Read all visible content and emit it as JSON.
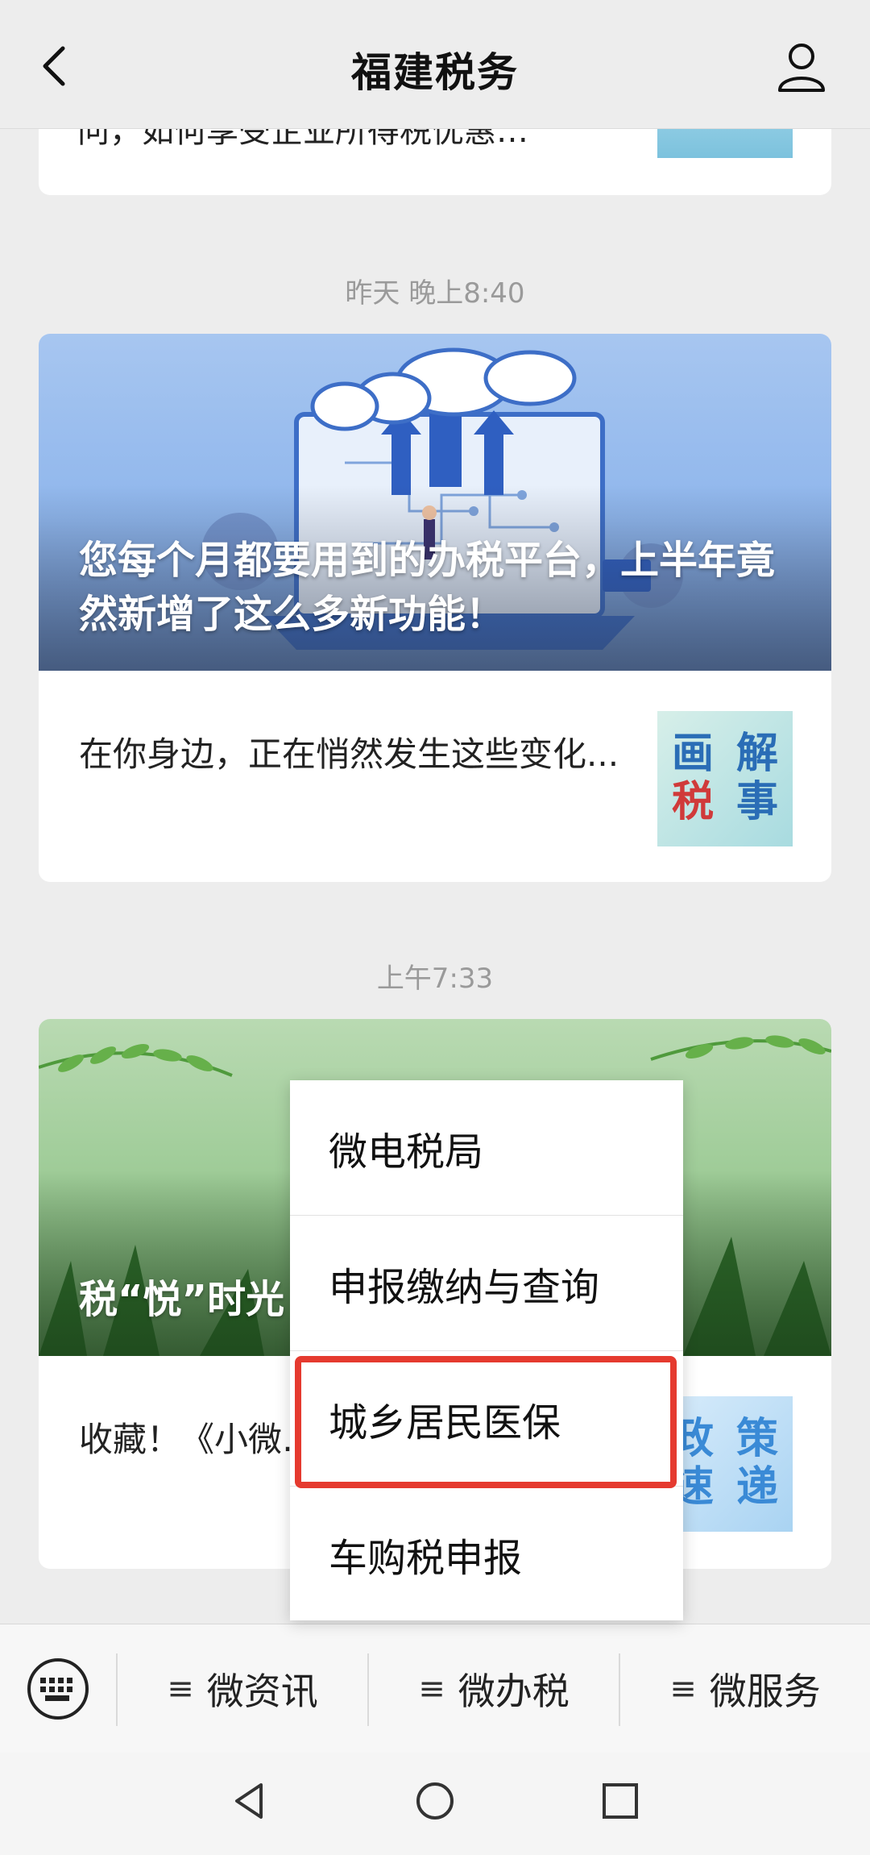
{
  "header": {
    "title": "福建税务"
  },
  "top_card": {
    "snippet": "问，如何享受企业所得税优惠…"
  },
  "timestamps": {
    "t1": "昨天 晚上8:40",
    "t2": "上午7:33"
  },
  "article_1": {
    "headline": "您每个月都要用到的办税平台，上半年竟然新增了这么多新功能！",
    "summary": "在你身边，正在悄然发生这些变化...",
    "thumb": [
      "画",
      "解",
      "税",
      "事"
    ]
  },
  "article_2": {
    "headline": "税“悦”时光",
    "summary": "收藏！《小微…费优惠政策指…",
    "thumb": [
      "政",
      "策",
      "速",
      "递"
    ]
  },
  "popup_menu": {
    "items": [
      "微电税局",
      "申报缴纳与查询",
      "城乡居民医保",
      "车购税申报"
    ],
    "highlighted_index": 2
  },
  "menubar": {
    "menus": [
      "微资讯",
      "微办税",
      "微服务"
    ],
    "menu_icon": "hamburger-icon"
  },
  "colors": {
    "highlight": "#e53a2f",
    "background": "#ededed"
  }
}
